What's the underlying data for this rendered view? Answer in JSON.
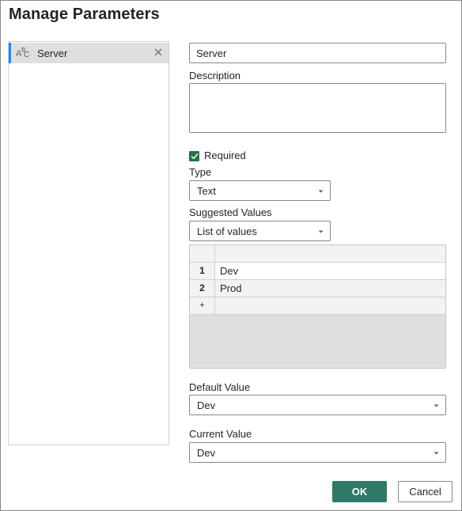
{
  "dialog": {
    "title": "Manage Parameters"
  },
  "parameters": [
    {
      "name": "Server",
      "type_icon": "text-type-icon",
      "selected": true
    }
  ],
  "form": {
    "name_value": "Server",
    "description_label": "Description",
    "description_value": "",
    "required_label": "Required",
    "required_checked": true,
    "type_label": "Type",
    "type_value": "Text",
    "suggested_label": "Suggested Values",
    "suggested_value": "List of values",
    "values": [
      {
        "num": "1",
        "value": "Dev"
      },
      {
        "num": "2",
        "value": "Prod"
      }
    ],
    "add_row_symbol": "+",
    "default_label": "Default Value",
    "default_value": "Dev",
    "current_label": "Current Value",
    "current_value": "Dev"
  },
  "buttons": {
    "ok": "OK",
    "cancel": "Cancel"
  },
  "colors": {
    "accent_green": "#217346",
    "ok_button": "#2e7a67",
    "selection_bar": "#118dff"
  }
}
